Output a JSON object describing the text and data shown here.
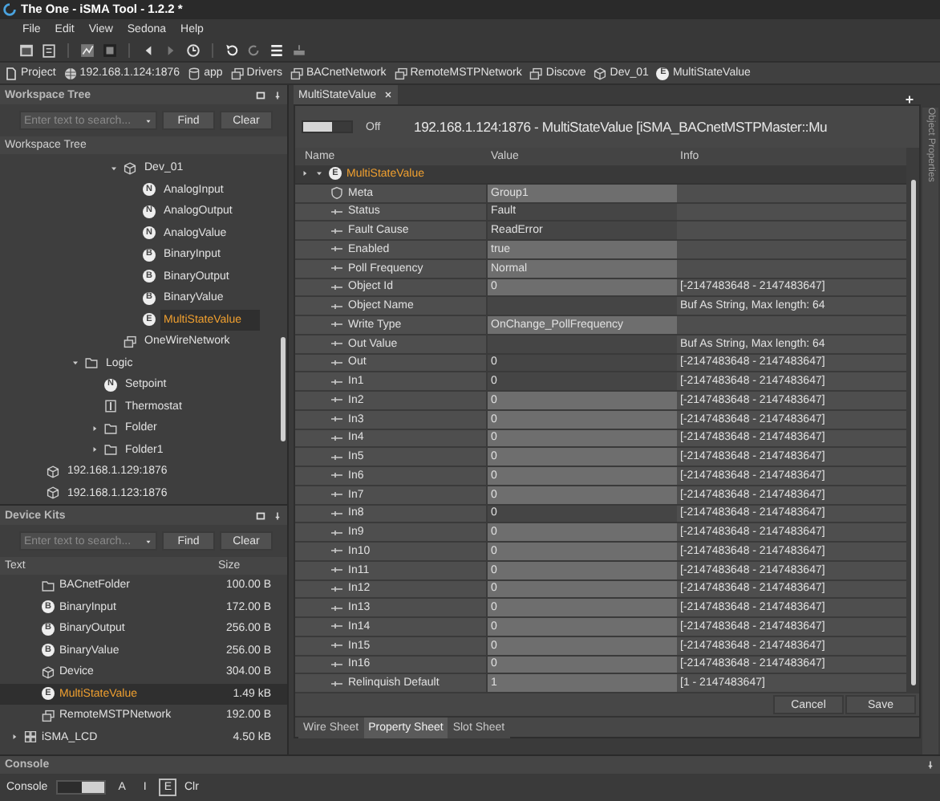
{
  "window": {
    "title": "The One - iSMA Tool - 1.2.2 *"
  },
  "menu": [
    "File",
    "Edit",
    "View",
    "Sedona",
    "Help"
  ],
  "breadcrumb": [
    {
      "label": "Project",
      "kind": "page"
    },
    {
      "label": "192.168.1.124:1876",
      "kind": "globe"
    },
    {
      "label": "app",
      "kind": "db"
    },
    {
      "label": "Drivers",
      "kind": "stack"
    },
    {
      "label": "BACnetNetwork",
      "kind": "stack"
    },
    {
      "label": "RemoteMSTPNetwork",
      "kind": "stack"
    },
    {
      "label": "Discove",
      "kind": "stack"
    },
    {
      "label": "Dev_01",
      "kind": "device"
    },
    {
      "label": "MultiStateValue",
      "kind": "letter",
      "badge": "E"
    }
  ],
  "workspace": {
    "title": "Workspace Tree",
    "search_placeholder": "Enter text to search...",
    "find": "Find",
    "clear": "Clear",
    "label": "Workspace Tree",
    "tree": [
      {
        "label": "Dev_01",
        "kind": "device",
        "expanded": true,
        "selected": false,
        "children": [
          {
            "label": "AnalogInput",
            "kind": "letter",
            "badge": "N",
            "selected": false
          },
          {
            "label": "AnalogOutput",
            "kind": "letter",
            "badge": "N",
            "selected": false
          },
          {
            "label": "AnalogValue",
            "kind": "letter",
            "badge": "N",
            "selected": false
          },
          {
            "label": "BinaryInput",
            "kind": "letter",
            "badge": "B",
            "selected": false
          },
          {
            "label": "BinaryOutput",
            "kind": "letter",
            "badge": "B",
            "selected": false
          },
          {
            "label": "BinaryValue",
            "kind": "letter",
            "badge": "B",
            "selected": false
          },
          {
            "label": "MultiStateValue",
            "kind": "letter",
            "badge": "E",
            "selected": true
          }
        ]
      },
      {
        "label": "OneWireNetwork",
        "kind": "stack",
        "selected": false
      },
      {
        "label": "Logic",
        "kind": "folder",
        "expanded": true,
        "selected": false,
        "children": [
          {
            "label": "Setpoint",
            "kind": "letter",
            "badge": "N",
            "selected": false
          },
          {
            "label": "Thermostat",
            "kind": "thermo",
            "selected": false
          },
          {
            "label": "Folder",
            "kind": "folder",
            "expanded": false,
            "selected": false
          },
          {
            "label": "Folder1",
            "kind": "folder",
            "expanded": false,
            "selected": false
          }
        ]
      },
      {
        "label": "192.168.1.129:1876",
        "kind": "device",
        "selected": false
      },
      {
        "label": "192.168.1.123:1876",
        "kind": "device",
        "selected": false
      }
    ]
  },
  "device_kits": {
    "title": "Device Kits",
    "search_placeholder": "Enter text to search...",
    "find": "Find",
    "clear": "Clear",
    "columns": [
      "Text",
      "Size"
    ],
    "rows": [
      {
        "label": "BACnetFolder",
        "size": "100.00 B",
        "kind": "folder",
        "selected": false
      },
      {
        "label": "BinaryInput",
        "size": "172.00 B",
        "kind": "letter",
        "badge": "B",
        "selected": false
      },
      {
        "label": "BinaryOutput",
        "size": "256.00 B",
        "kind": "letter",
        "badge": "B",
        "selected": false
      },
      {
        "label": "BinaryValue",
        "size": "256.00 B",
        "kind": "letter",
        "badge": "B",
        "selected": false
      },
      {
        "label": "Device",
        "size": "304.00 B",
        "kind": "device",
        "selected": false
      },
      {
        "label": "MultiStateValue",
        "size": "1.49 kB",
        "kind": "letter",
        "badge": "E",
        "selected": true
      },
      {
        "label": "RemoteMSTPNetwork",
        "size": "192.00 B",
        "kind": "stack",
        "selected": false
      },
      {
        "label": "iSMA_LCD",
        "size": "4.50 kB",
        "kind": "grid",
        "selected": false,
        "expanded": false
      }
    ]
  },
  "editor": {
    "tab": "MultiStateValue",
    "toggle": {
      "label": "Off",
      "on": false
    },
    "title": "192.168.1.124:1876 - MultiStateValue [iSMA_BACnetMSTPMaster::Mu",
    "columns": [
      "Name",
      "Value",
      "Info"
    ],
    "root": {
      "label": "MultiStateValue",
      "badge": "E"
    },
    "rows": [
      {
        "name": "Meta",
        "value": "Group1",
        "info": "",
        "kind": "meta",
        "editable": true
      },
      {
        "name": "Status",
        "value": "Fault",
        "info": "",
        "kind": "slot",
        "editable": false
      },
      {
        "name": "Fault Cause",
        "value": "ReadError",
        "info": "",
        "kind": "slot",
        "editable": false
      },
      {
        "name": "Enabled",
        "value": "true",
        "info": "",
        "kind": "slot",
        "editable": true
      },
      {
        "name": "Poll Frequency",
        "value": "Normal",
        "info": "",
        "kind": "slot",
        "editable": true
      },
      {
        "name": "Object Id",
        "value": "0",
        "info": "[-2147483648 - 2147483647]",
        "kind": "slot",
        "editable": true
      },
      {
        "name": "Object Name",
        "value": "",
        "info": "Buf As String, Max length: 64",
        "kind": "slot",
        "editable": false
      },
      {
        "name": "Write Type",
        "value": "OnChange_PollFrequency",
        "info": "",
        "kind": "slot",
        "editable": true
      },
      {
        "name": "Out Value",
        "value": "",
        "info": "Buf As String, Max length: 64",
        "kind": "slot",
        "editable": false
      },
      {
        "name": "Out",
        "value": "0",
        "info": "[-2147483648 - 2147483647]",
        "kind": "slot",
        "editable": false
      },
      {
        "name": "In1",
        "value": "0",
        "info": "[-2147483648 - 2147483647]",
        "kind": "slot",
        "editable": false
      },
      {
        "name": "In2",
        "value": "0",
        "info": "[-2147483648 - 2147483647]",
        "kind": "slot",
        "editable": true
      },
      {
        "name": "In3",
        "value": "0",
        "info": "[-2147483648 - 2147483647]",
        "kind": "slot",
        "editable": true
      },
      {
        "name": "In4",
        "value": "0",
        "info": "[-2147483648 - 2147483647]",
        "kind": "slot",
        "editable": true
      },
      {
        "name": "In5",
        "value": "0",
        "info": "[-2147483648 - 2147483647]",
        "kind": "slot",
        "editable": true
      },
      {
        "name": "In6",
        "value": "0",
        "info": "[-2147483648 - 2147483647]",
        "kind": "slot",
        "editable": true
      },
      {
        "name": "In7",
        "value": "0",
        "info": "[-2147483648 - 2147483647]",
        "kind": "slot",
        "editable": true
      },
      {
        "name": "In8",
        "value": "0",
        "info": "[-2147483648 - 2147483647]",
        "kind": "slot",
        "editable": false
      },
      {
        "name": "In9",
        "value": "0",
        "info": "[-2147483648 - 2147483647]",
        "kind": "slot",
        "editable": true
      },
      {
        "name": "In10",
        "value": "0",
        "info": "[-2147483648 - 2147483647]",
        "kind": "slot",
        "editable": true
      },
      {
        "name": "In11",
        "value": "0",
        "info": "[-2147483648 - 2147483647]",
        "kind": "slot",
        "editable": true
      },
      {
        "name": "In12",
        "value": "0",
        "info": "[-2147483648 - 2147483647]",
        "kind": "slot",
        "editable": true
      },
      {
        "name": "In13",
        "value": "0",
        "info": "[-2147483648 - 2147483647]",
        "kind": "slot",
        "editable": true
      },
      {
        "name": "In14",
        "value": "0",
        "info": "[-2147483648 - 2147483647]",
        "kind": "slot",
        "editable": true
      },
      {
        "name": "In15",
        "value": "0",
        "info": "[-2147483648 - 2147483647]",
        "kind": "slot",
        "editable": true
      },
      {
        "name": "In16",
        "value": "0",
        "info": "[-2147483648 - 2147483647]",
        "kind": "slot",
        "editable": true
      },
      {
        "name": "Relinquish Default",
        "value": "1",
        "info": "[1 - 2147483647]",
        "kind": "slot",
        "editable": true
      }
    ],
    "buttons": [
      "Cancel",
      "Save"
    ],
    "sheets": [
      {
        "label": "Wire Sheet",
        "selected": false
      },
      {
        "label": "Property Sheet",
        "selected": true
      },
      {
        "label": "Slot Sheet",
        "selected": false
      }
    ]
  },
  "side_panel": "Object Properties",
  "console": {
    "title": "Console",
    "label": "Console",
    "toggle_on": true,
    "filters": [
      {
        "label": "A",
        "selected": false
      },
      {
        "label": "I",
        "selected": false
      },
      {
        "label": "E",
        "selected": true
      }
    ],
    "clear": "Clr"
  }
}
